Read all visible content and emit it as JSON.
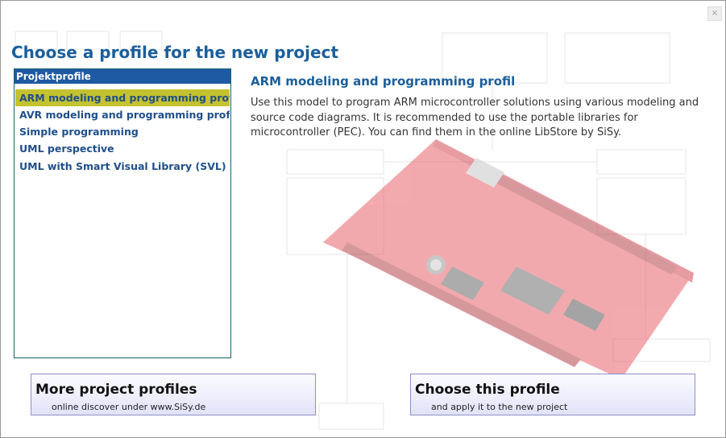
{
  "window": {
    "close_glyph": "×"
  },
  "page_title": "Choose a profile for the new project",
  "profile_list": {
    "header": "Projektprofile",
    "items": [
      {
        "label": "ARM modeling and programming profil",
        "selected": true
      },
      {
        "label": "AVR modeling and programming profil",
        "selected": false
      },
      {
        "label": "Simple programming",
        "selected": false
      },
      {
        "label": "UML perspective",
        "selected": false
      },
      {
        "label": "UML with Smart Visual Library (SVL)",
        "selected": false
      }
    ]
  },
  "detail": {
    "title": "ARM modeling and programming profil",
    "description": "Use this model to program ARM microcontroller solutions using various modeling and source code diagrams. It is recommended to use the portable libraries for microcontroller (PEC). You can find them in the online LibStore by SiSy.",
    "board_image": "red-microcontroller-board-photo"
  },
  "buttons": {
    "more": {
      "title": "More project profiles",
      "subtitle": "online discover under www.SiSy.de"
    },
    "choose": {
      "title": "Choose this profile",
      "subtitle": "and apply it to the new project"
    }
  },
  "colors": {
    "title_blue": "#1b5f9b",
    "list_header": "#1e5aa3",
    "selected_item": "#c4c22e",
    "button_border": "#8f8fc9"
  }
}
